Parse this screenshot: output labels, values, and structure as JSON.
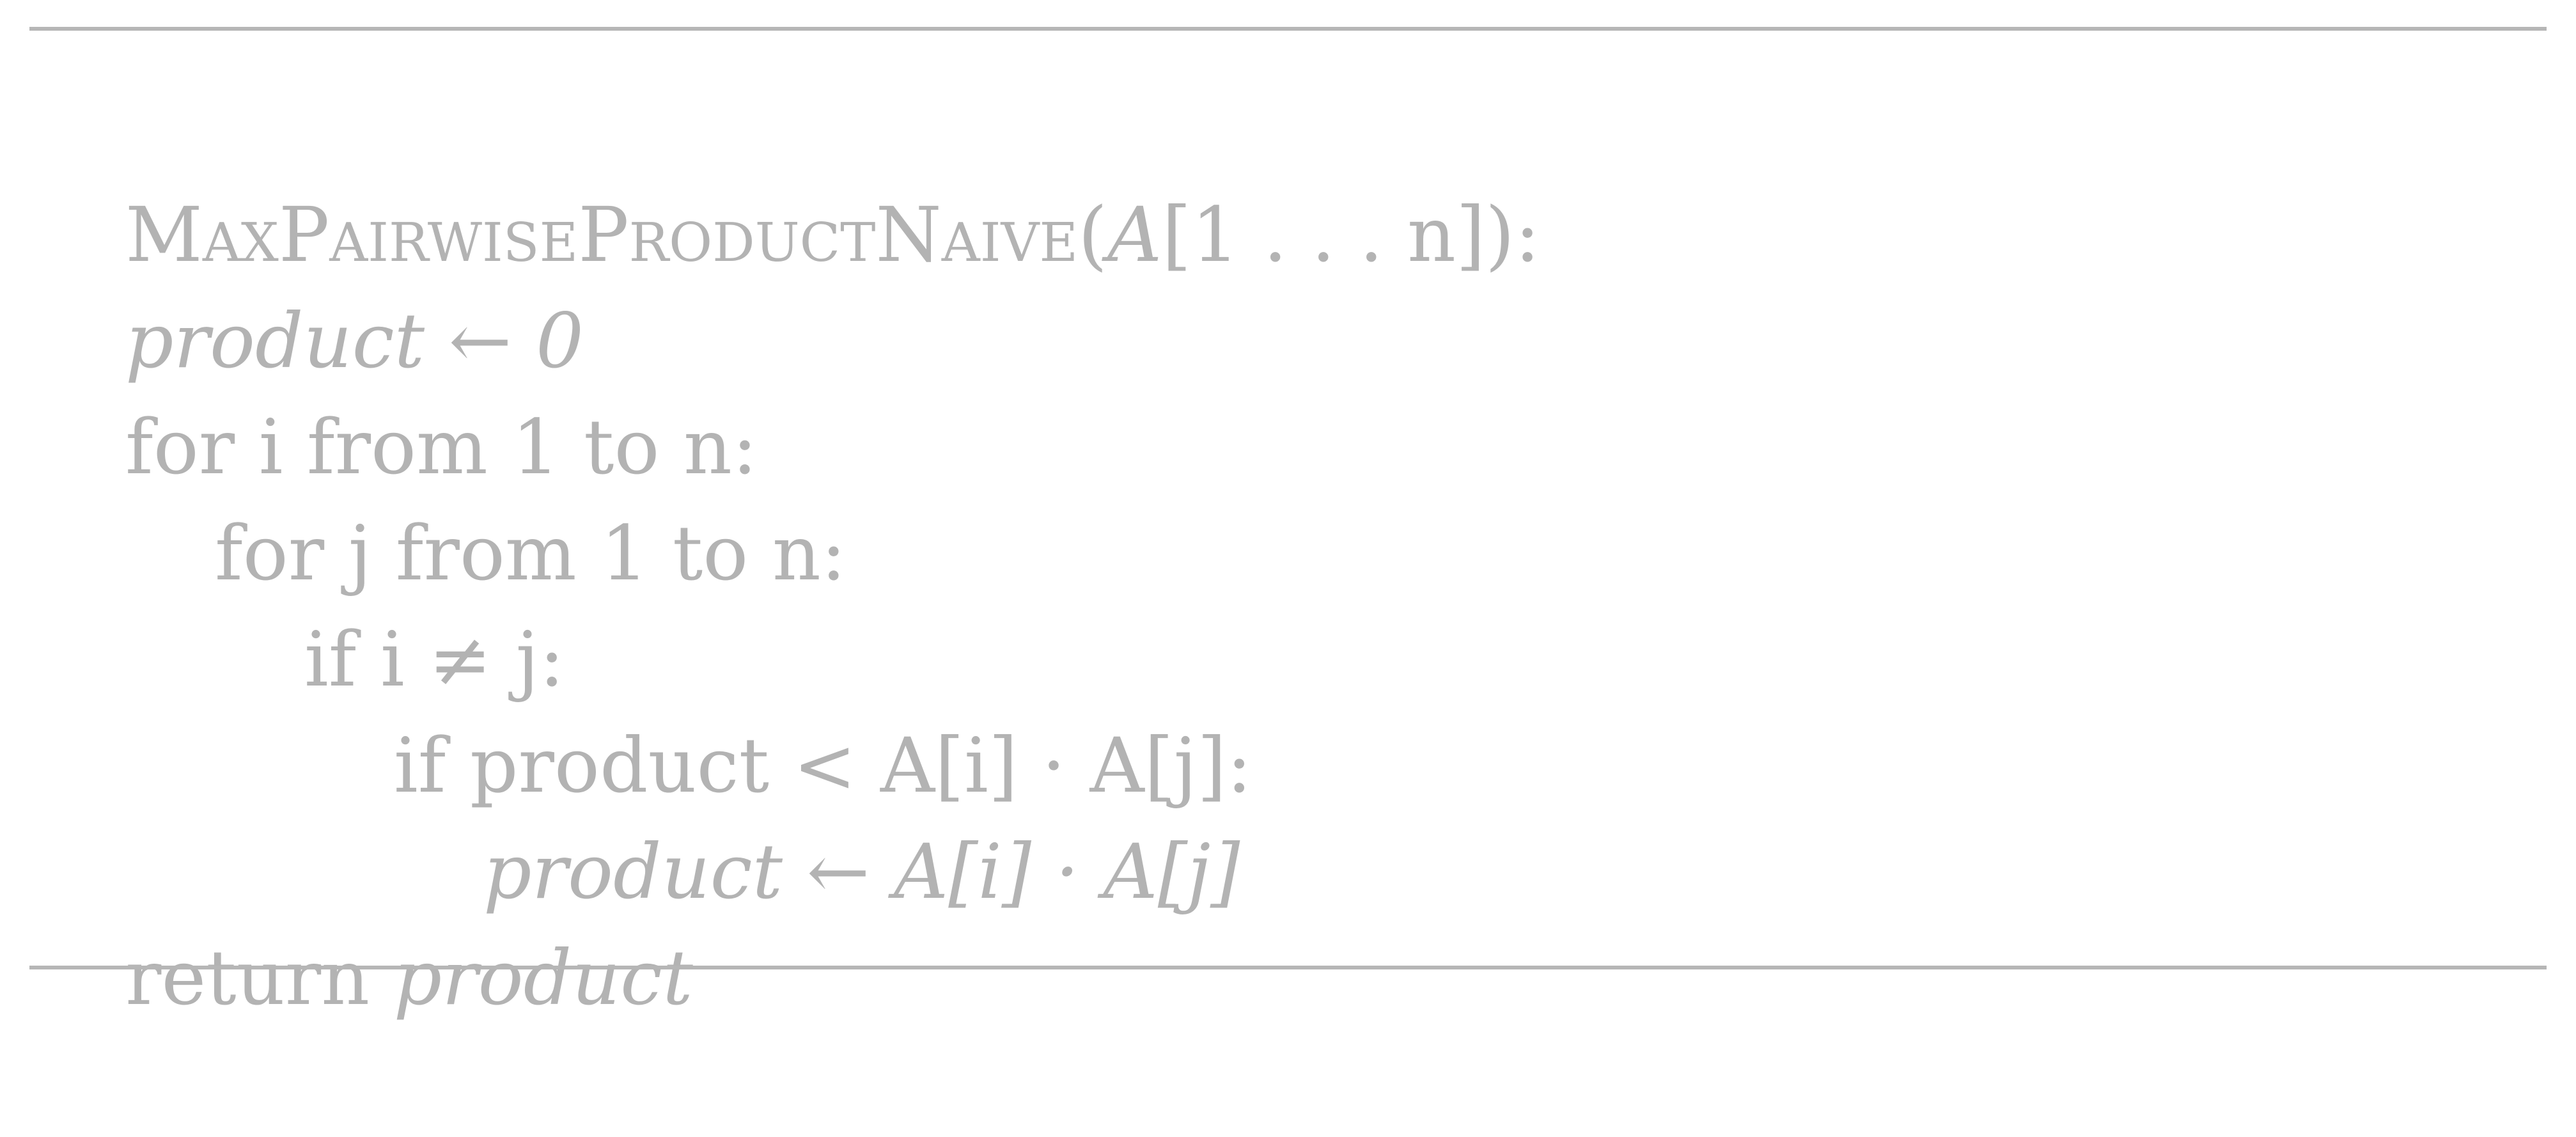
{
  "algorithm": {
    "name": "MaxPairwiseProductNaive",
    "signature": {
      "open": "(",
      "array": "A",
      "range": "[1 . . . n]",
      "close": "):"
    },
    "lines": [
      {
        "kw": "",
        "expr": "product ← 0"
      },
      {
        "kw": "for",
        "expr": "i from 1 to n:"
      },
      {
        "kw": "for",
        "expr": "j from 1 to n:"
      },
      {
        "kw": "if",
        "expr": "i ≠ j:"
      },
      {
        "kw": "if",
        "expr": "product < A[i] · A[j]:"
      },
      {
        "kw": "",
        "expr": "product ← A[i] · A[j]"
      },
      {
        "kw": "return",
        "expr": "product"
      }
    ]
  },
  "colors": {
    "text": "#b3b3b3",
    "rule": "#b6b6b6",
    "background": "#ffffff"
  }
}
